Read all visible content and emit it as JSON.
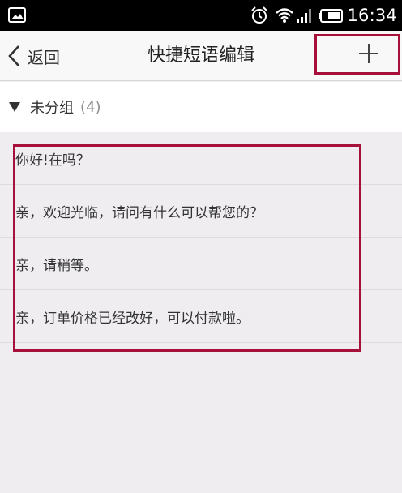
{
  "status_bar": {
    "time": "16:34",
    "icons": [
      "image-icon",
      "alarm-icon",
      "wifi-icon",
      "signal-icon",
      "battery-icon"
    ]
  },
  "header": {
    "back_label": "返回",
    "title": "快捷短语编辑",
    "add_icon": "plus-icon"
  },
  "group": {
    "name": "未分组",
    "count": "(4)",
    "icon": "triangle-down-icon"
  },
  "phrases": [
    "你好!在吗？",
    "亲，欢迎光临，请问有什么可以帮您的？",
    "亲，请稍等。",
    "亲，订单价格已经改好，可以付款啦。"
  ],
  "colors": {
    "highlight": "#a7103a",
    "background": "#efedf0"
  }
}
